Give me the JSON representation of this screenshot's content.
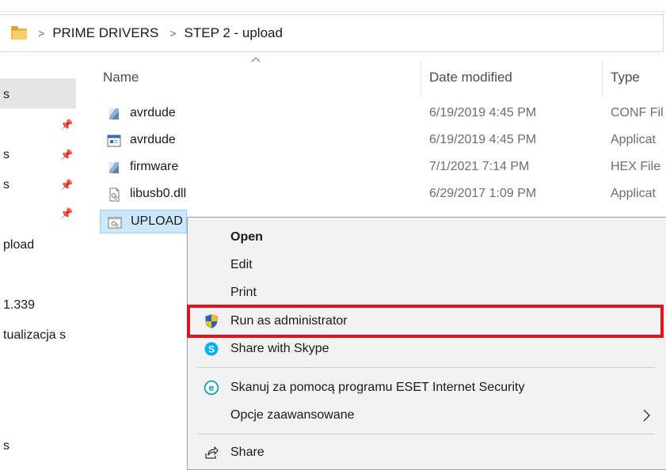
{
  "breadcrumb": {
    "items": [
      "PRIME DRIVERS",
      "STEP 2 - upload"
    ],
    "separator": ">"
  },
  "nav_pane": {
    "items": [
      "s",
      "s",
      "s",
      "pload",
      "1.339",
      "tualizacja s",
      "s"
    ]
  },
  "columns": {
    "name": "Name",
    "date_modified": "Date modified",
    "type": "Type"
  },
  "files": [
    {
      "name": "avrdude",
      "date": "6/19/2019 4:45 PM",
      "type": "CONF Fil",
      "icon": "conf-file-icon"
    },
    {
      "name": "avrdude",
      "date": "6/19/2019 4:45 PM",
      "type": "Applicat",
      "icon": "application-icon"
    },
    {
      "name": "firmware",
      "date": "7/1/2021 7:14 PM",
      "type": "HEX File",
      "icon": "hex-file-icon"
    },
    {
      "name": "libusb0.dll",
      "date": "6/29/2017 1:09 PM",
      "type": "Applicat",
      "icon": "dll-file-icon"
    },
    {
      "name": "UPLOAD",
      "date": "",
      "type": "",
      "icon": "batch-file-icon"
    }
  ],
  "context_menu": {
    "open": "Open",
    "edit": "Edit",
    "print": "Print",
    "run_as_admin": "Run as administrator",
    "share_skype": "Share with Skype",
    "eset_scan": "Skanuj za pomocą programu ESET Internet Security",
    "advanced_options": "Opcje zaawansowane",
    "share": "Share"
  },
  "colors": {
    "selection": "#cce8ff",
    "highlight": "#e0141e",
    "skype": "#00aff0",
    "eset": "#0097a7"
  }
}
